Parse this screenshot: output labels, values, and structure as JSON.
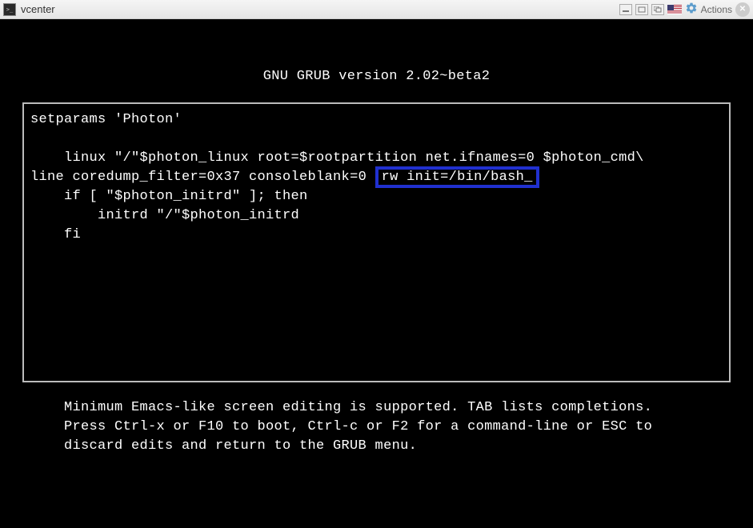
{
  "titlebar": {
    "title": "vcenter",
    "actions_label": "Actions"
  },
  "grub": {
    "header": "GNU GRUB  version 2.02~beta2",
    "editor": {
      "line1": "setparams 'Photon'",
      "line2": "",
      "line3_pre": "    linux \"/\"$photon_linux root=$rootpartition net.ifnames=0 $photon_cmd\\",
      "line4_pre": "line coredump_filter=0x37 consoleblank=0 ",
      "line4_highlight": "rw init=/bin/bash_",
      "line5": "    if [ \"$photon_initrd\" ]; then",
      "line6": "        initrd \"/\"$photon_initrd",
      "line7": "    fi"
    },
    "footer": "Minimum Emacs-like screen editing is supported. TAB lists completions. Press Ctrl-x or F10 to boot, Ctrl-c or F2 for a command-line or ESC to discard edits and return to the GRUB menu."
  }
}
